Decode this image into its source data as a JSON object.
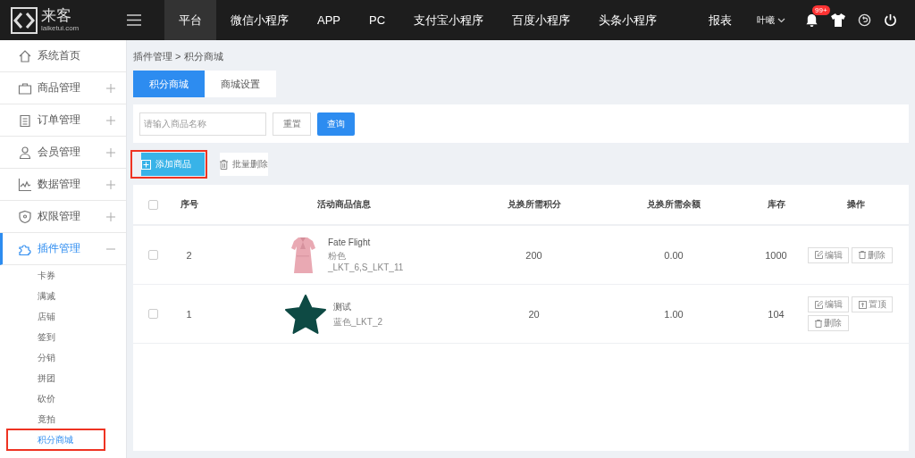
{
  "logo": {
    "name": "来客",
    "domain": "laiketui.com"
  },
  "top_nav": [
    {
      "label": "平台",
      "selected": true
    },
    {
      "label": "微信小程序",
      "selected": false
    },
    {
      "label": "APP",
      "selected": false
    },
    {
      "label": "PC",
      "selected": false
    },
    {
      "label": "支付宝小程序",
      "selected": false
    },
    {
      "label": "百度小程序",
      "selected": false
    },
    {
      "label": "头条小程序",
      "selected": false
    },
    {
      "label": "报表",
      "selected": false
    }
  ],
  "user": {
    "name": "叶曦"
  },
  "notifications": {
    "badge": "99+"
  },
  "sidebar": {
    "items": [
      {
        "label": "系统首页",
        "expandable": false,
        "expanded": false
      },
      {
        "label": "商品管理",
        "expandable": true,
        "expanded": false
      },
      {
        "label": "订单管理",
        "expandable": true,
        "expanded": false
      },
      {
        "label": "会员管理",
        "expandable": true,
        "expanded": false
      },
      {
        "label": "数据管理",
        "expandable": true,
        "expanded": false
      },
      {
        "label": "权限管理",
        "expandable": true,
        "expanded": false
      },
      {
        "label": "插件管理",
        "expandable": true,
        "expanded": true,
        "children": [
          {
            "label": "卡券",
            "selected": false,
            "highlighted": false
          },
          {
            "label": "满减",
            "selected": false,
            "highlighted": false
          },
          {
            "label": "店铺",
            "selected": false,
            "highlighted": false
          },
          {
            "label": "签到",
            "selected": false,
            "highlighted": false
          },
          {
            "label": "分销",
            "selected": false,
            "highlighted": false
          },
          {
            "label": "拼团",
            "selected": false,
            "highlighted": false
          },
          {
            "label": "砍价",
            "selected": false,
            "highlighted": false
          },
          {
            "label": "竟拍",
            "selected": false,
            "highlighted": false
          },
          {
            "label": "积分商城",
            "selected": true,
            "highlighted": true
          }
        ]
      }
    ]
  },
  "breadcrumb": {
    "items": [
      "插件管理",
      "积分商城"
    ],
    "separator": ">"
  },
  "tabs": [
    {
      "label": "积分商城",
      "selected": true
    },
    {
      "label": "商城设置",
      "selected": false
    }
  ],
  "search": {
    "placeholder": "请输入商品名称",
    "reset": "重置",
    "submit": "查询"
  },
  "actions": [
    {
      "label": "添加商品",
      "kind": "primary",
      "highlighted": true
    },
    {
      "label": "批量删除",
      "kind": "plain",
      "highlighted": false
    }
  ],
  "table": {
    "header_checked": false,
    "columns": [
      "序号",
      "活动商品信息",
      "兑换所需积分",
      "兑换所需余额",
      "库存",
      "操作"
    ],
    "rows": [
      {
        "checked": false,
        "seq": "2",
        "thumb": {
          "kind": "picture"
        },
        "name": "Fate Flight",
        "specs": [
          "粉色",
          "_LKT_6,S_LKT_11"
        ],
        "points": "200",
        "balance": "0.00",
        "stock": "1000",
        "ops": [
          {
            "label": "编辑",
            "kind": "edit"
          },
          {
            "label": "删除",
            "kind": "delete"
          }
        ]
      },
      {
        "checked": false,
        "seq": "1",
        "thumb": {
          "kind": "star"
        },
        "name": "测试",
        "specs": [
          "蓝色_LKT_2"
        ],
        "points": "20",
        "balance": "1.00",
        "stock": "104",
        "ops": [
          {
            "label": "编辑",
            "kind": "edit"
          },
          {
            "label": "置顶",
            "kind": "top"
          },
          {
            "label": "删除",
            "kind": "delete"
          }
        ]
      }
    ]
  }
}
